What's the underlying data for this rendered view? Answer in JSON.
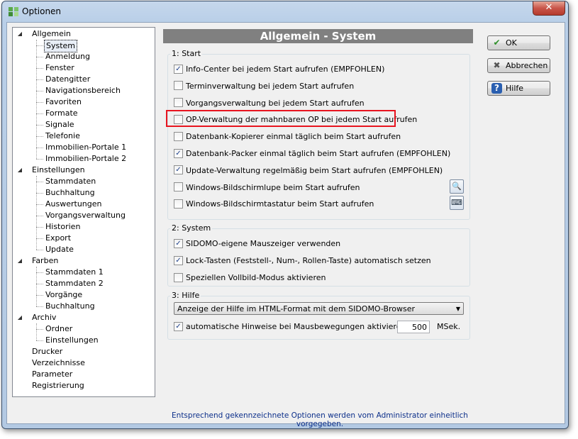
{
  "window": {
    "title": "Optionen",
    "close_label": "✕"
  },
  "tree": {
    "items": [
      {
        "label": "Allgemein",
        "level": 0,
        "expanded": true
      },
      {
        "label": "System",
        "level": 1,
        "selected": true
      },
      {
        "label": "Anmeldung",
        "level": 1
      },
      {
        "label": "Fenster",
        "level": 1
      },
      {
        "label": "Datengitter",
        "level": 1
      },
      {
        "label": "Navigationsbereich",
        "level": 1
      },
      {
        "label": "Favoriten",
        "level": 1
      },
      {
        "label": "Formate",
        "level": 1
      },
      {
        "label": "Signale",
        "level": 1
      },
      {
        "label": "Telefonie",
        "level": 1
      },
      {
        "label": "Immobilien-Portale 1",
        "level": 1
      },
      {
        "label": "Immobilien-Portale 2",
        "level": 1
      },
      {
        "label": "Einstellungen",
        "level": 0,
        "expanded": true
      },
      {
        "label": "Stammdaten",
        "level": 1
      },
      {
        "label": "Buchhaltung",
        "level": 1
      },
      {
        "label": "Auswertungen",
        "level": 1
      },
      {
        "label": "Vorgangsverwaltung",
        "level": 1
      },
      {
        "label": "Historien",
        "level": 1
      },
      {
        "label": "Export",
        "level": 1
      },
      {
        "label": "Update",
        "level": 1
      },
      {
        "label": "Farben",
        "level": 0,
        "expanded": true
      },
      {
        "label": "Stammdaten 1",
        "level": 1
      },
      {
        "label": "Stammdaten 2",
        "level": 1
      },
      {
        "label": "Vorgänge",
        "level": 1
      },
      {
        "label": "Buchhaltung",
        "level": 1
      },
      {
        "label": "Archiv",
        "level": 0,
        "expanded": true
      },
      {
        "label": "Ordner",
        "level": 1
      },
      {
        "label": "Einstellungen",
        "level": 1
      },
      {
        "label": "Drucker",
        "level": 0
      },
      {
        "label": "Verzeichnisse",
        "level": 0
      },
      {
        "label": "Parameter",
        "level": 0
      },
      {
        "label": "Registrierung",
        "level": 0
      }
    ]
  },
  "panel": {
    "header": "Allgemein - System",
    "group_start": {
      "label": "1: Start",
      "options": [
        {
          "label": "Info-Center bei jedem Start aufrufen (EMPFOHLEN)",
          "checked": true
        },
        {
          "label": "Terminverwaltung bei jedem Start aufrufen",
          "checked": false
        },
        {
          "label": "Vorgangsverwaltung bei jedem Start aufrufen",
          "checked": false
        },
        {
          "label": "OP-Verwaltung der mahnbaren OP bei jedem Start aufrufen",
          "checked": false,
          "highlighted": true
        },
        {
          "label": "Datenbank-Kopierer einmal täglich beim Start aufrufen",
          "checked": false
        },
        {
          "label": "Datenbank-Packer einmal täglich beim Start aufrufen (EMPFOHLEN)",
          "checked": true
        },
        {
          "label": "Update-Verwaltung regelmäßig beim Start aufrufen (EMPFOHLEN)",
          "checked": true
        },
        {
          "label": "Windows-Bildschirmlupe beim Start aufrufen",
          "checked": false
        },
        {
          "label": "Windows-Bildschirmtastatur beim Start aufrufen",
          "checked": false
        }
      ]
    },
    "group_system": {
      "label": "2: System",
      "options": [
        {
          "label": "SIDOMO-eigene Mauszeiger verwenden",
          "checked": true
        },
        {
          "label": "Lock-Tasten (Feststell-, Num-, Rollen-Taste) automatisch setzen",
          "checked": true
        },
        {
          "label": "Speziellen Vollbild-Modus aktivieren",
          "checked": false
        }
      ]
    },
    "group_hilfe": {
      "label": "3: Hilfe",
      "select_value": "Anzeige der Hilfe im HTML-Format mit dem SIDOMO-Browser",
      "hint_label": "automatische Hinweise bei Mausbewegungen aktivieren nach",
      "hint_checked": true,
      "hint_value": "500",
      "hint_unit": "MSek."
    }
  },
  "buttons": {
    "ok": "OK",
    "cancel": "Abbrechen",
    "help": "Hilfe"
  },
  "footer": "Entsprechend gekennzeichnete Optionen werden vom Administrator einheitlich vorgegeben.",
  "colors": {
    "highlight": "#e8141f",
    "header_bg": "#808080",
    "footer_text": "#0c2f8a"
  }
}
